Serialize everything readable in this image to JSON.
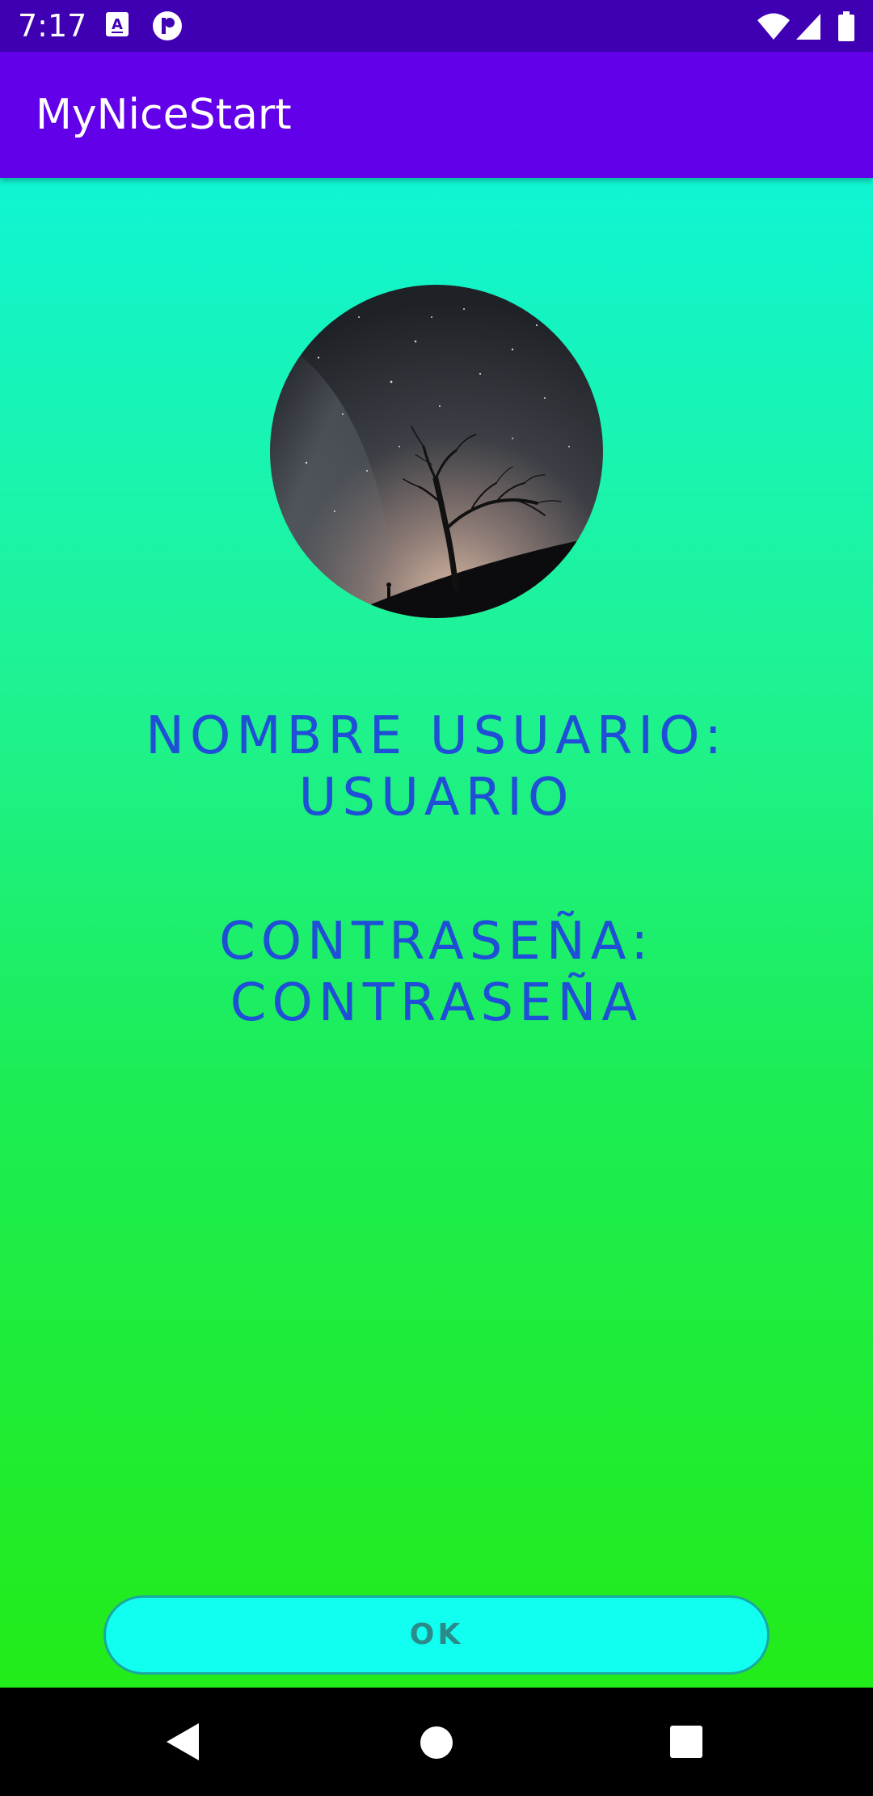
{
  "status_bar": {
    "time": "7:17",
    "icons": [
      "a-notification-icon",
      "p-notification-icon",
      "wifi-icon",
      "signal-icon",
      "battery-icon"
    ]
  },
  "app_bar": {
    "title": "MyNiceStart"
  },
  "main": {
    "avatar_icon": "night-sky-tree-avatar",
    "username_label": "NOMBRE USUARIO:",
    "username_value": "USUARIO",
    "password_label": "CONTRASEÑA:",
    "password_value": "CONTRASEÑA",
    "ok_label": "OK"
  },
  "nav_bar": {
    "icons": [
      "back-icon",
      "home-icon",
      "recents-icon"
    ]
  },
  "colors": {
    "status_bar": "#3f00b4",
    "app_bar": "#6200ea",
    "gradient_top": "#10f5d3",
    "gradient_bottom": "#22ec19",
    "text_accent": "#1f4fd6",
    "button_fill": "#10fff0"
  }
}
